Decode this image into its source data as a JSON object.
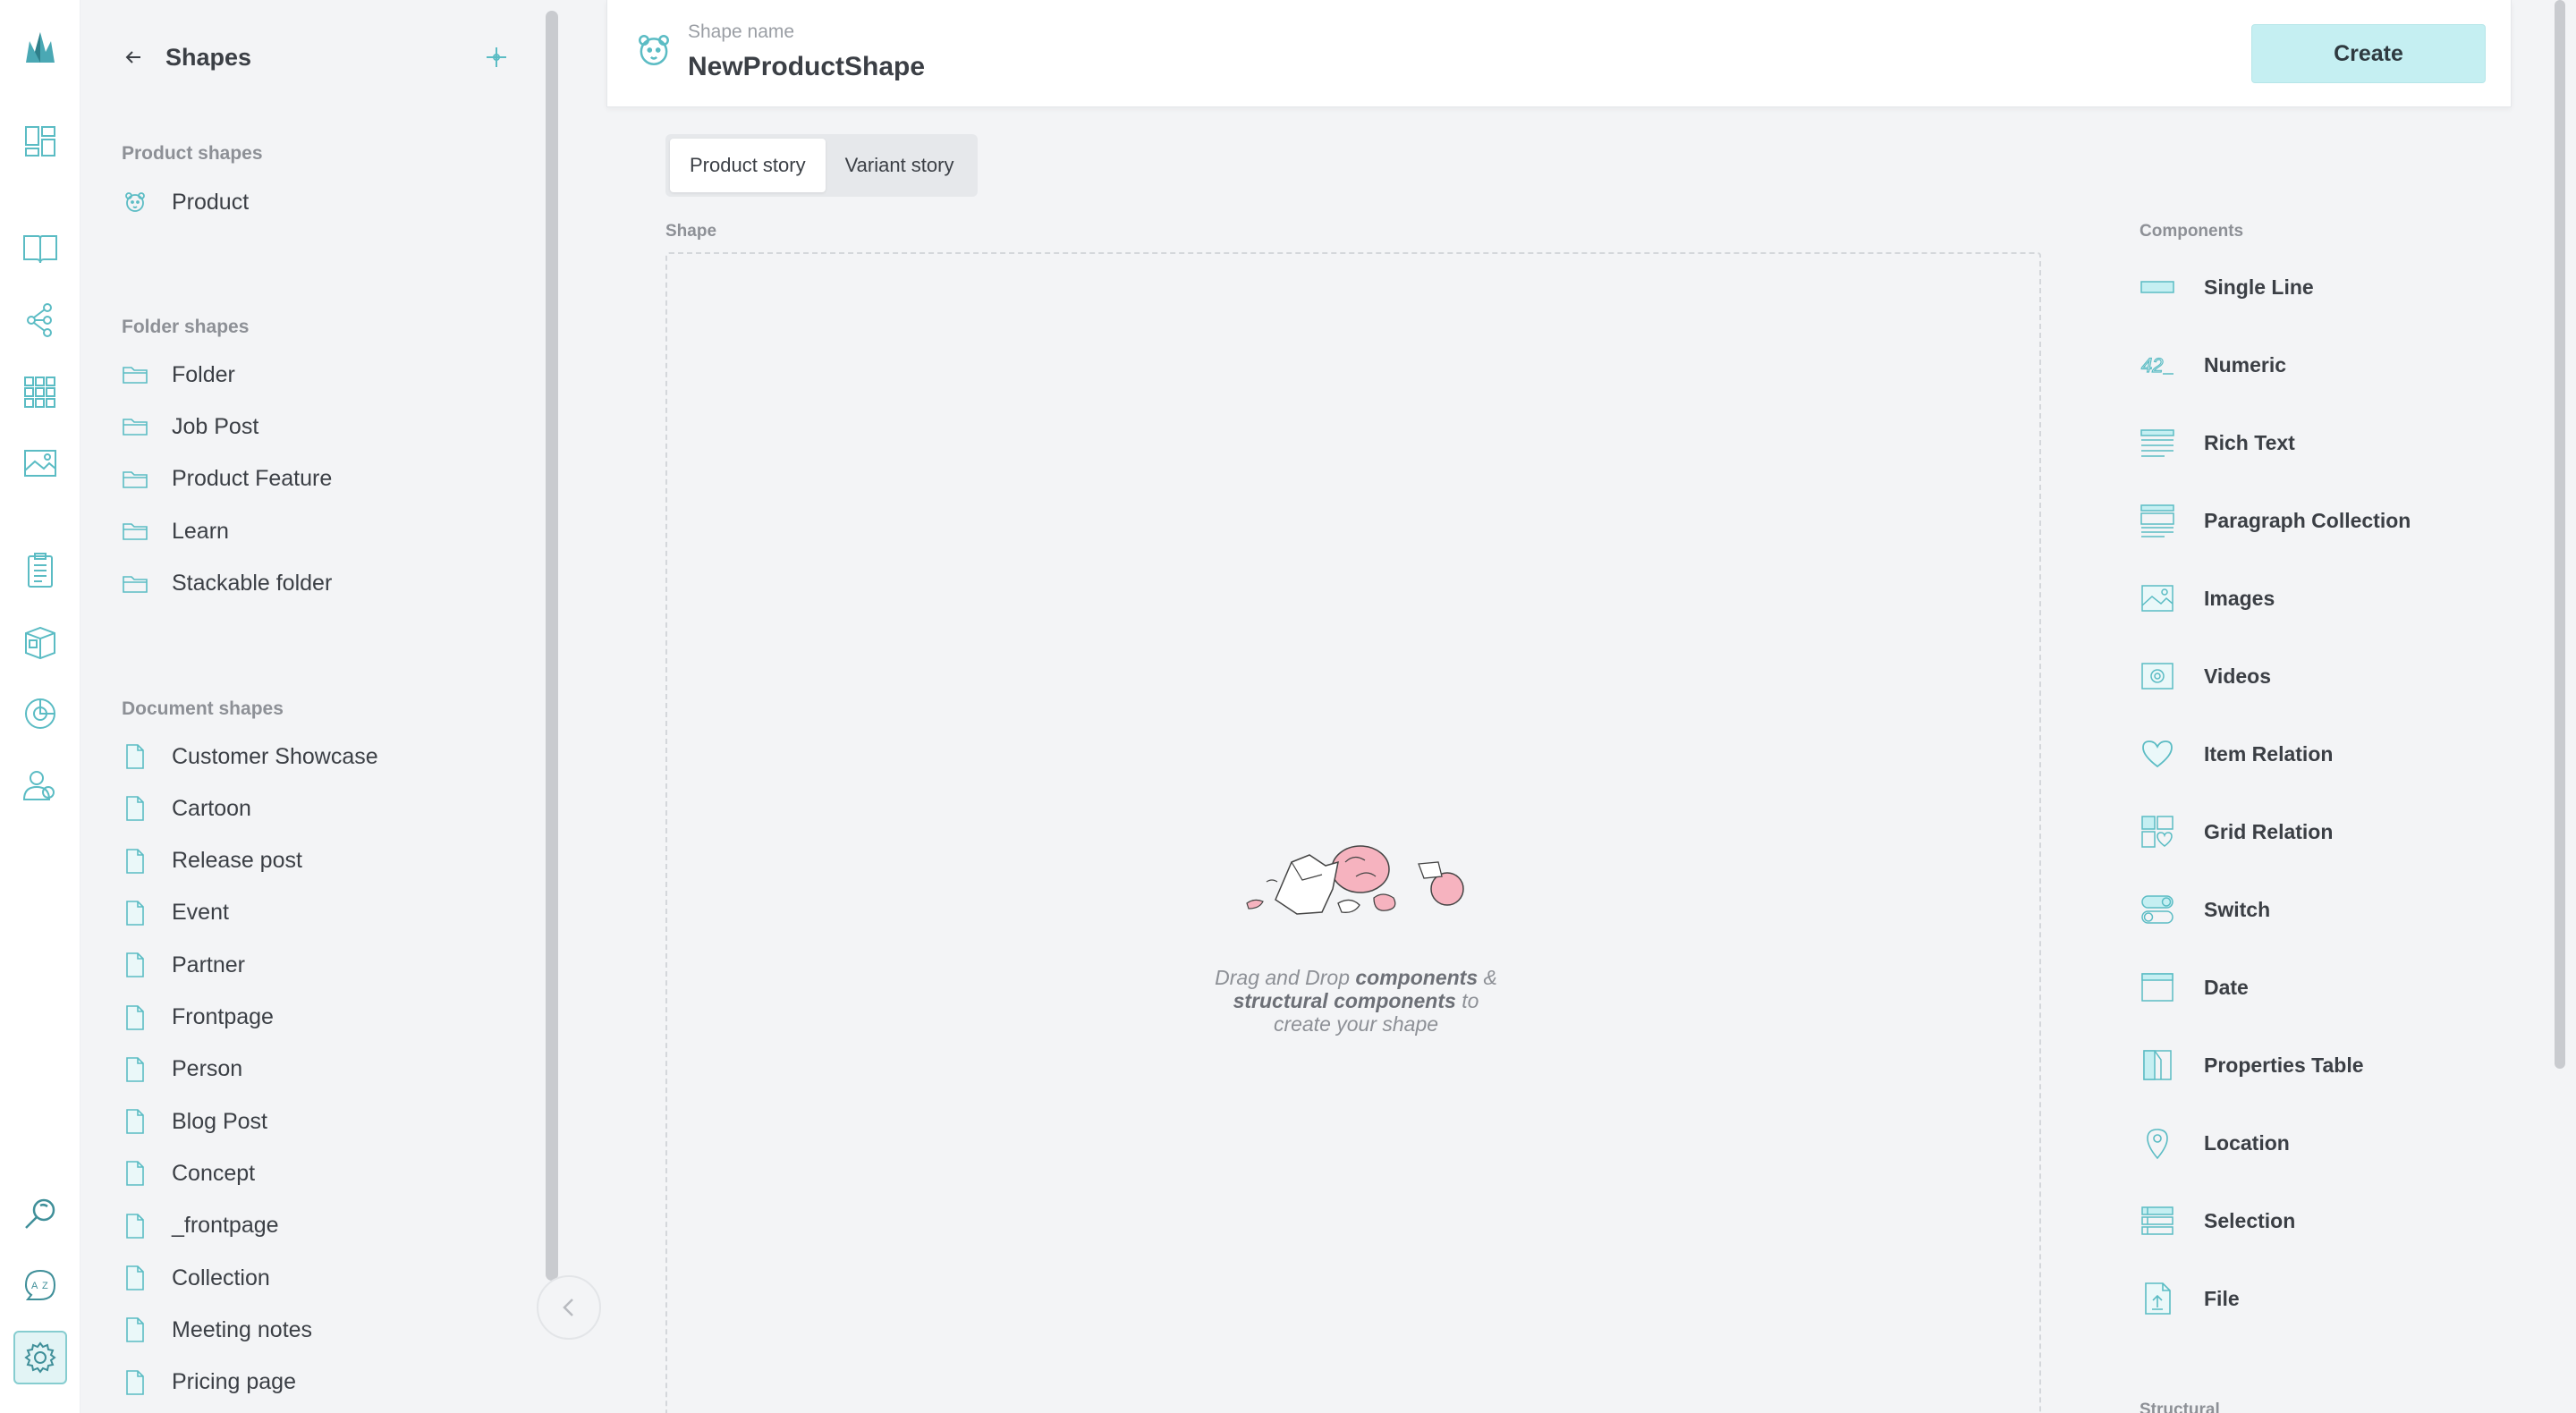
{
  "rail": {
    "items": [
      {
        "icon": "crystallize-logo-icon",
        "active": false
      },
      {
        "icon": "dashboard-icon",
        "active": false
      },
      {
        "icon": "catalogue-book-icon",
        "active": false
      },
      {
        "icon": "topics-tree-icon",
        "active": false
      },
      {
        "icon": "grids-icon",
        "active": false
      },
      {
        "icon": "media-image-icon",
        "active": false
      },
      {
        "icon": "orders-clipboard-icon",
        "active": false
      },
      {
        "icon": "subscriptions-box-icon",
        "active": false
      },
      {
        "icon": "analytics-pie-icon",
        "active": false
      },
      {
        "icon": "customers-icon",
        "active": false
      },
      {
        "icon": "search-icon",
        "active": false
      },
      {
        "icon": "translate-icon",
        "active": false
      },
      {
        "icon": "settings-gear-icon",
        "active": true
      }
    ]
  },
  "sidebar": {
    "title": "Shapes",
    "sections": [
      {
        "title": "Product shapes",
        "items": [
          {
            "label": "Product",
            "icon": "product-bear-icon"
          }
        ]
      },
      {
        "title": "Folder shapes",
        "items": [
          {
            "label": "Folder",
            "icon": "folder-icon"
          },
          {
            "label": "Job Post",
            "icon": "folder-icon"
          },
          {
            "label": "Product Feature",
            "icon": "folder-icon"
          },
          {
            "label": "Learn",
            "icon": "folder-icon"
          },
          {
            "label": "Stackable folder",
            "icon": "folder-icon"
          }
        ]
      },
      {
        "title": "Document shapes",
        "items": [
          {
            "label": "Customer Showcase",
            "icon": "document-icon"
          },
          {
            "label": "Cartoon",
            "icon": "document-icon"
          },
          {
            "label": "Release post",
            "icon": "document-icon"
          },
          {
            "label": "Event",
            "icon": "document-icon"
          },
          {
            "label": "Partner",
            "icon": "document-icon"
          },
          {
            "label": "Frontpage",
            "icon": "document-icon"
          },
          {
            "label": "Person",
            "icon": "document-icon"
          },
          {
            "label": "Blog Post",
            "icon": "document-icon"
          },
          {
            "label": "Concept",
            "icon": "document-icon"
          },
          {
            "label": "_frontpage",
            "icon": "document-icon"
          },
          {
            "label": "Collection",
            "icon": "document-icon"
          },
          {
            "label": "Meeting notes",
            "icon": "document-icon"
          },
          {
            "label": "Pricing page",
            "icon": "document-icon"
          }
        ]
      }
    ]
  },
  "topbar": {
    "name_label": "Shape name",
    "name_value": "NewProductShape",
    "create_label": "Create"
  },
  "tabs": [
    {
      "label": "Product story",
      "active": true
    },
    {
      "label": "Variant story",
      "active": false
    }
  ],
  "shape_area": {
    "label": "Shape",
    "empty_line1_a": "Drag and Drop ",
    "empty_line1_b": "components",
    "empty_line1_c": " &",
    "empty_line2_a": "structural components",
    "empty_line2_b": " to",
    "empty_line3": "create your shape"
  },
  "components": {
    "title": "Components",
    "items": [
      {
        "label": "Single Line",
        "icon": "single-line-icon"
      },
      {
        "label": "Numeric",
        "icon": "numeric-icon"
      },
      {
        "label": "Rich Text",
        "icon": "rich-text-icon"
      },
      {
        "label": "Paragraph Collection",
        "icon": "paragraph-collection-icon"
      },
      {
        "label": "Images",
        "icon": "images-icon"
      },
      {
        "label": "Videos",
        "icon": "videos-icon"
      },
      {
        "label": "Item Relation",
        "icon": "item-relation-heart-icon"
      },
      {
        "label": "Grid Relation",
        "icon": "grid-relation-icon"
      },
      {
        "label": "Switch",
        "icon": "switch-icon"
      },
      {
        "label": "Date",
        "icon": "date-icon"
      },
      {
        "label": "Properties Table",
        "icon": "properties-table-icon"
      },
      {
        "label": "Location",
        "icon": "location-pin-icon"
      },
      {
        "label": "Selection",
        "icon": "selection-icon"
      },
      {
        "label": "File",
        "icon": "file-upload-icon"
      }
    ],
    "structural_title": "Structural"
  },
  "colors": {
    "accent": "#5bbcc4",
    "accent_light": "#c5eff2",
    "pink": "#f4a7b4"
  }
}
